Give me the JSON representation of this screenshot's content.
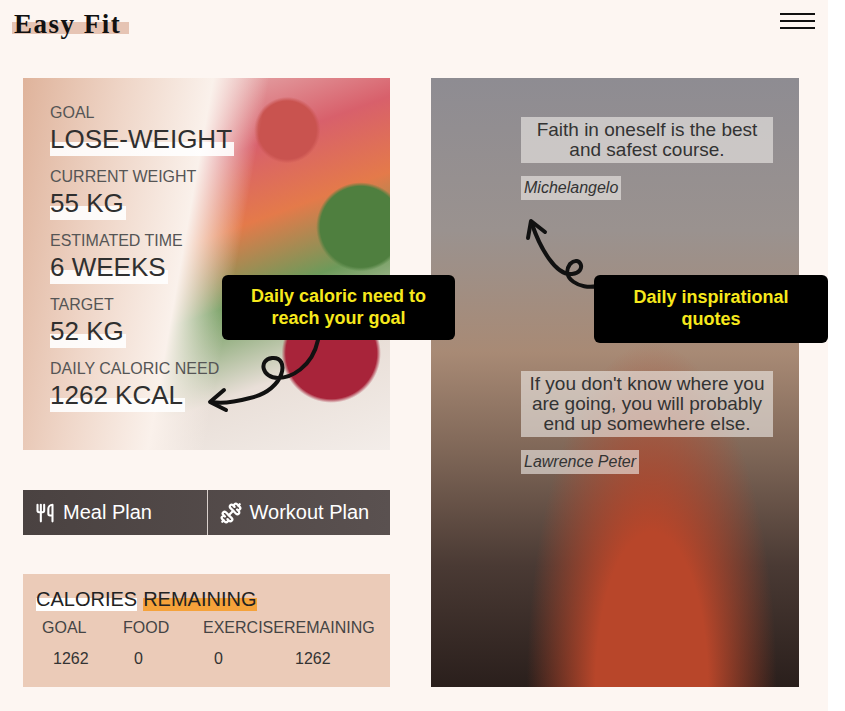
{
  "header": {
    "logo": "Easy Fit"
  },
  "goal_card": {
    "fields": [
      {
        "label": "GOAL",
        "value": "LOSE-WEIGHT"
      },
      {
        "label": "CURRENT WEIGHT",
        "value": "55 KG"
      },
      {
        "label": "ESTIMATED TIME",
        "value": "6 WEEKS"
      },
      {
        "label": "TARGET",
        "value": "52 KG"
      },
      {
        "label": "DAILY CALORIC NEED",
        "value": "1262 KCAL"
      }
    ]
  },
  "plan_buttons": [
    {
      "label": "Meal Plan",
      "kind": "meal"
    },
    {
      "label": "Workout Plan",
      "kind": "workout"
    }
  ],
  "calories": {
    "title": "CALORIES",
    "title_highlight": "REMAINING",
    "columns": [
      {
        "label": "GOAL",
        "value": "1262"
      },
      {
        "label": "FOOD",
        "value": "0"
      },
      {
        "label": "EXERCISE",
        "value": "0"
      },
      {
        "label": "REMAINING",
        "value": "1262"
      }
    ]
  },
  "quotes": [
    {
      "text": "Faith in oneself is the best and safest course.",
      "author": "Michelangelo"
    },
    {
      "text": "If you don't know where you are going, you will probably end up somewhere else.",
      "author": "Lawrence Peter"
    }
  ],
  "annotations": [
    {
      "text": "Daily caloric need to reach your goal"
    },
    {
      "text": "Daily inspirational quotes"
    }
  ]
}
